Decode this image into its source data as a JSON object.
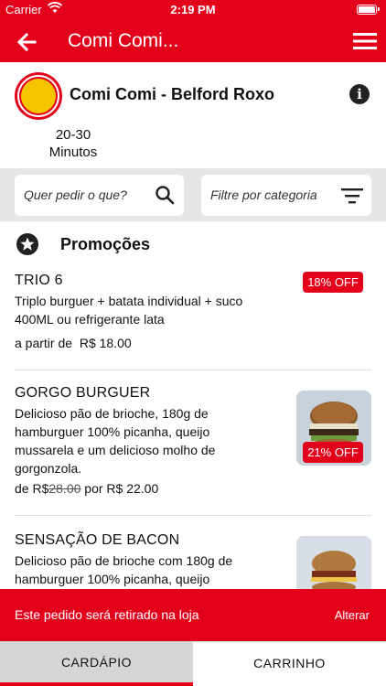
{
  "status_bar": {
    "carrier": "Carrier",
    "time": "2:19 PM"
  },
  "nav": {
    "title": "Comi Comi..."
  },
  "store": {
    "name": "Comi Comi - Belford Roxo",
    "eta_line1": "20-30",
    "eta_line2": "Minutos"
  },
  "filters": {
    "search_placeholder": "Quer pedir o que?",
    "category_placeholder": "Filtre por categoria"
  },
  "section": {
    "title": "Promoções"
  },
  "items": [
    {
      "name": "TRIO 6",
      "desc": "Triplo burguer + batata individual + suco 400ML ou refrigerante lata",
      "price_prefix": "a partir de",
      "price": "R$ 18.00",
      "badge": "18% OFF"
    },
    {
      "name": "GORGO BURGUER",
      "desc": "Delicioso pão de brioche, 180g de hamburguer 100% picanha, queijo mussarela e um delicioso molho de gorgonzola.",
      "price_prefix": "de R$",
      "old_price": "28.00",
      "price_mid": "por",
      "price": "R$ 22.00",
      "badge": "21% OFF"
    },
    {
      "name": "SENSAÇÃO DE BACON",
      "desc": "Delicioso pão de brioche com 180g de hamburguer 100% picanha, queijo"
    }
  ],
  "banner": {
    "message": "Este pedido será retirado na loja",
    "action": "Alterar"
  },
  "tabs": {
    "menu": "CARDÁPIO",
    "cart": "CARRINHO"
  },
  "colors": {
    "brand": "#e3001b"
  }
}
